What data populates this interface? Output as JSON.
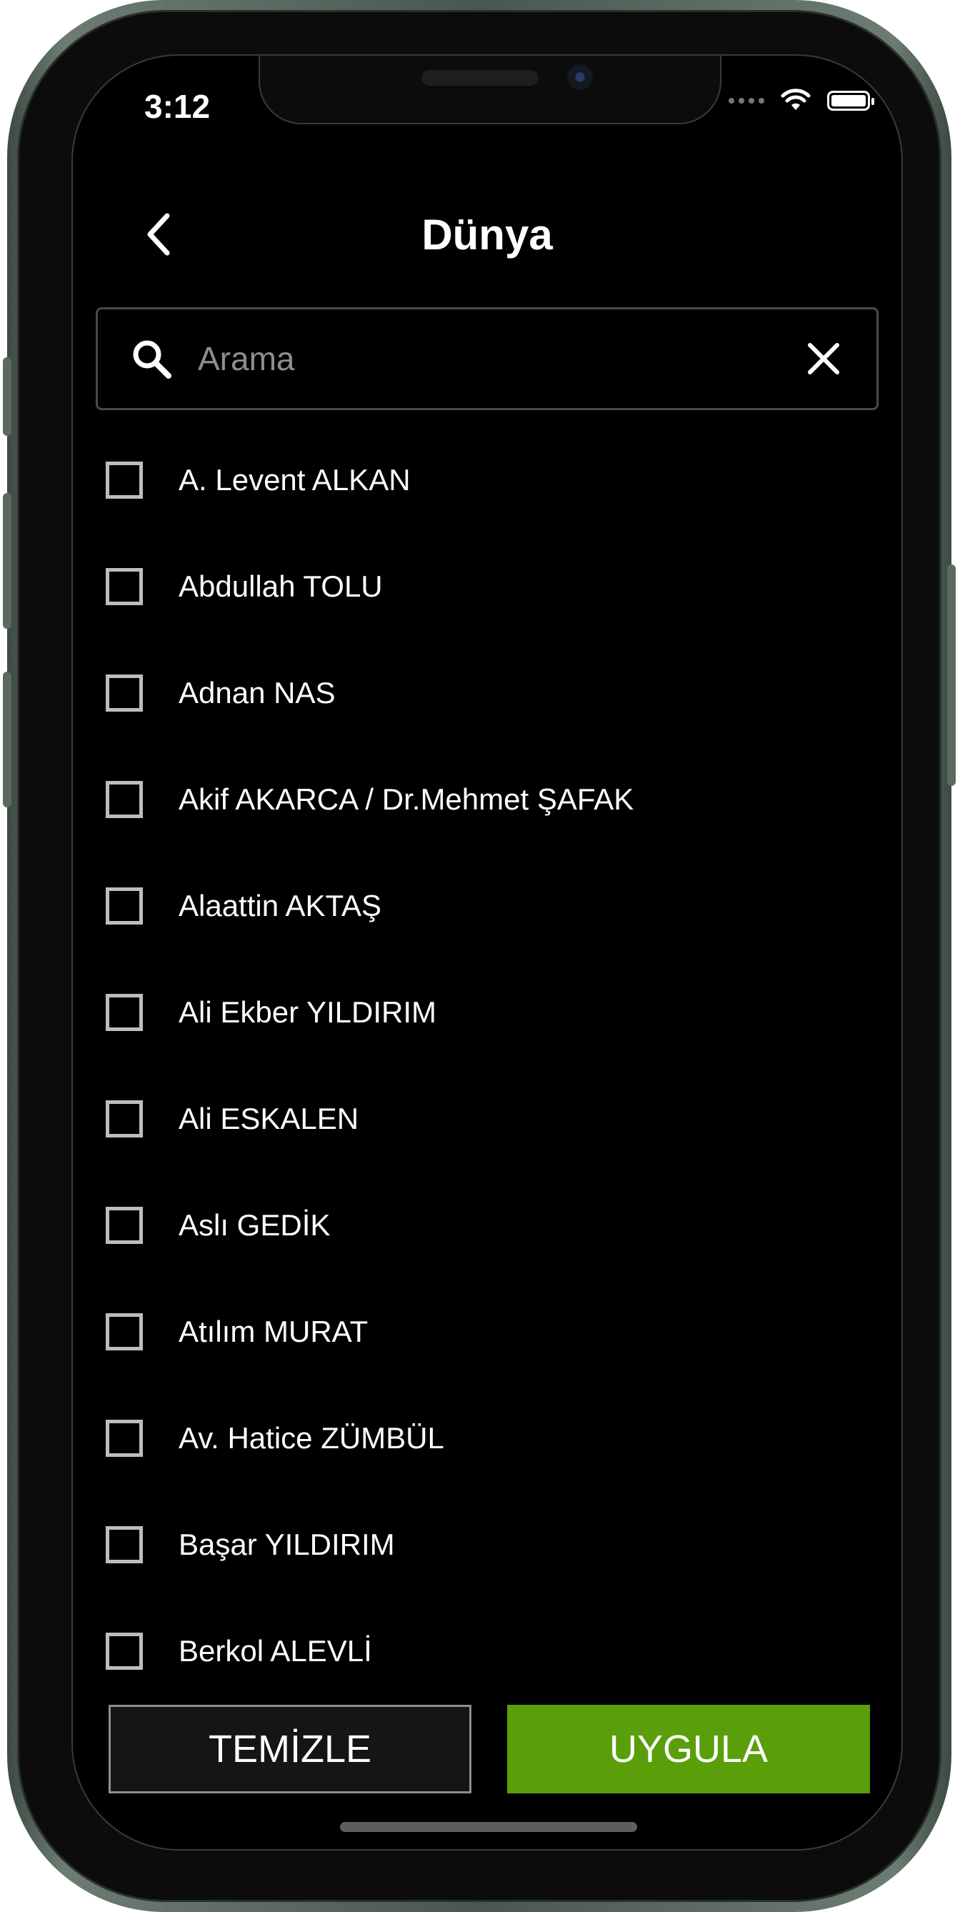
{
  "status_bar": {
    "time": "3:12"
  },
  "header": {
    "title": "Dünya",
    "back_icon": "chevron-left-icon"
  },
  "search": {
    "placeholder": "Arama",
    "value": "",
    "search_icon": "search-icon",
    "clear_icon": "close-icon"
  },
  "list": {
    "items": [
      {
        "label": "A. Levent ALKAN",
        "checked": false
      },
      {
        "label": "Abdullah TOLU",
        "checked": false
      },
      {
        "label": "Adnan NAS",
        "checked": false
      },
      {
        "label": "Akif AKARCA / Dr.Mehmet ŞAFAK",
        "checked": false
      },
      {
        "label": "Alaattin AKTAŞ",
        "checked": false
      },
      {
        "label": "Ali Ekber YILDIRIM",
        "checked": false
      },
      {
        "label": "Ali ESKALEN",
        "checked": false
      },
      {
        "label": "Aslı GEDİK",
        "checked": false
      },
      {
        "label": "Atılım MURAT",
        "checked": false
      },
      {
        "label": "Av. Hatice ZÜMBÜL",
        "checked": false
      },
      {
        "label": "Başar YILDIRIM",
        "checked": false
      },
      {
        "label": "Berkol ALEVLİ",
        "checked": false
      }
    ]
  },
  "actions": {
    "clear_label": "TEMİZLE",
    "apply_label": "UYGULA"
  },
  "colors": {
    "background": "#000000",
    "accent": "#5a9e0a",
    "checkbox_border": "#bdbdbd",
    "text": "#ffffff",
    "placeholder": "#8e8e8e"
  }
}
